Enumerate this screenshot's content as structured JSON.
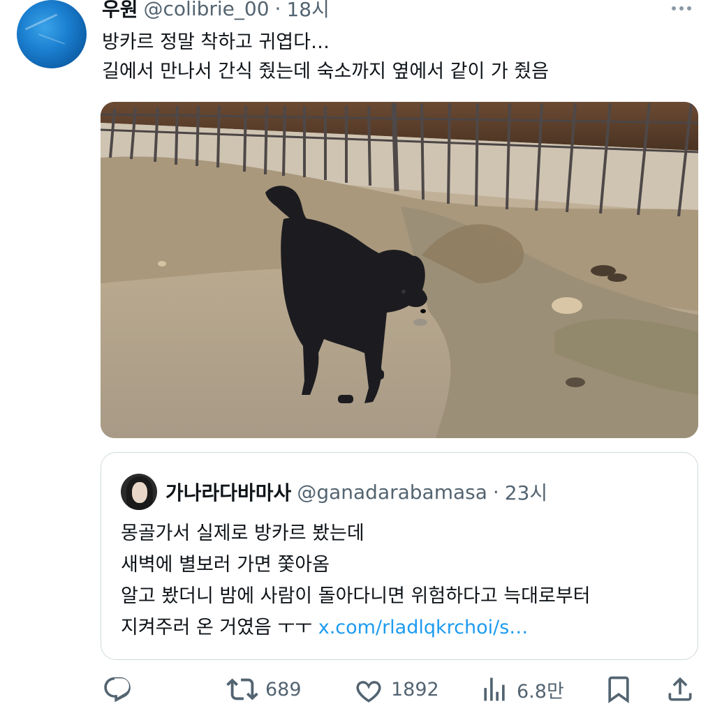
{
  "tweet": {
    "display_name": "우원",
    "handle": "@colibrie_00",
    "separator": "·",
    "time": "18시",
    "lines": [
      "방카르 정말 착하고 귀엽다…",
      "길에서 만나서 간식 줬는데 숙소까지 옆에서 같이 가 줬음"
    ],
    "more_icon": "more-horizontal-icon",
    "avatar_color": "#1b7fd0"
  },
  "quote": {
    "display_name": "가나라다바마사",
    "handle": "@ganadarabamasa",
    "separator": "·",
    "time": "23시",
    "lines": [
      "몽골가서 실제로 방카르 봤는데",
      "새벽에 별보러 가면 쫓아옴",
      "알고 봤더니 밤에 사람이 돌아다니면 위험하다고 늑대로부터"
    ],
    "last_line_text": "지켜주러 온 거였음 ㅜㅜ",
    "link": "x.com/rladlqkrchoi/s…",
    "link_color": "#1d9bf0"
  },
  "actions": {
    "reply_icon": "reply-icon",
    "retweet_icon": "retweet-icon",
    "retweet_count": "689",
    "like_icon": "heart-icon",
    "like_count": "1892",
    "views_icon": "views-icon",
    "views_count": "6.8만",
    "bookmark_icon": "bookmark-icon",
    "share_icon": "share-icon",
    "icon_color": "#536471"
  }
}
